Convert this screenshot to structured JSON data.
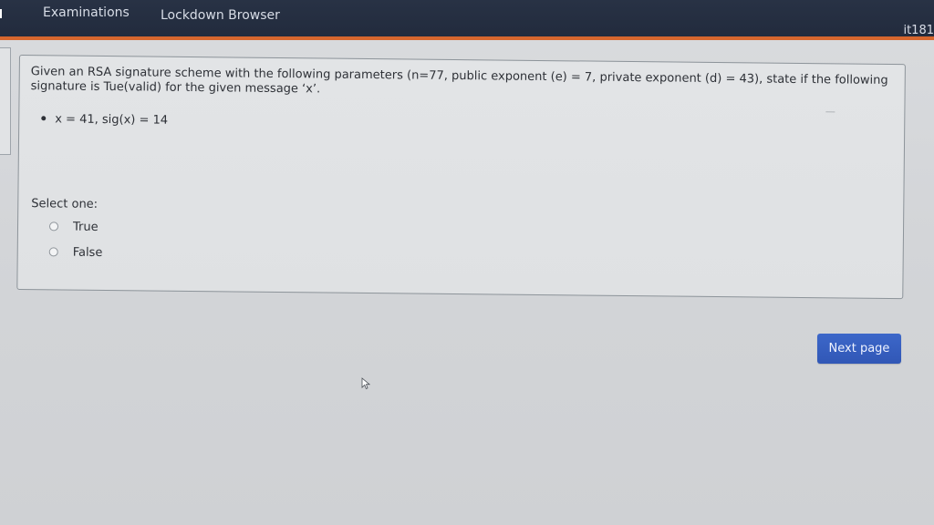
{
  "header": {
    "nav": {
      "examinations": "Examinations",
      "lockdown_browser": "Lockdown Browser"
    },
    "user": "it181"
  },
  "question": {
    "text": "Given an RSA signature scheme with the following parameters (n=77, public exponent (e) = 7, private exponent (d) = 43), state if the following signature is Tue(valid) for the given message ‘x’.",
    "bullet": "x = 41, sig(x) = 14"
  },
  "answer": {
    "prompt": "Select one:",
    "options": [
      {
        "label": "True",
        "selected": false
      },
      {
        "label": "False",
        "selected": false
      }
    ]
  },
  "footer": {
    "next_button": "Next page"
  },
  "colors": {
    "header_background": "#252f42",
    "header_accent": "#d7672e",
    "primary_button": "#3560c4"
  },
  "icons": {
    "cursor": "arrow-cursor-icon"
  }
}
